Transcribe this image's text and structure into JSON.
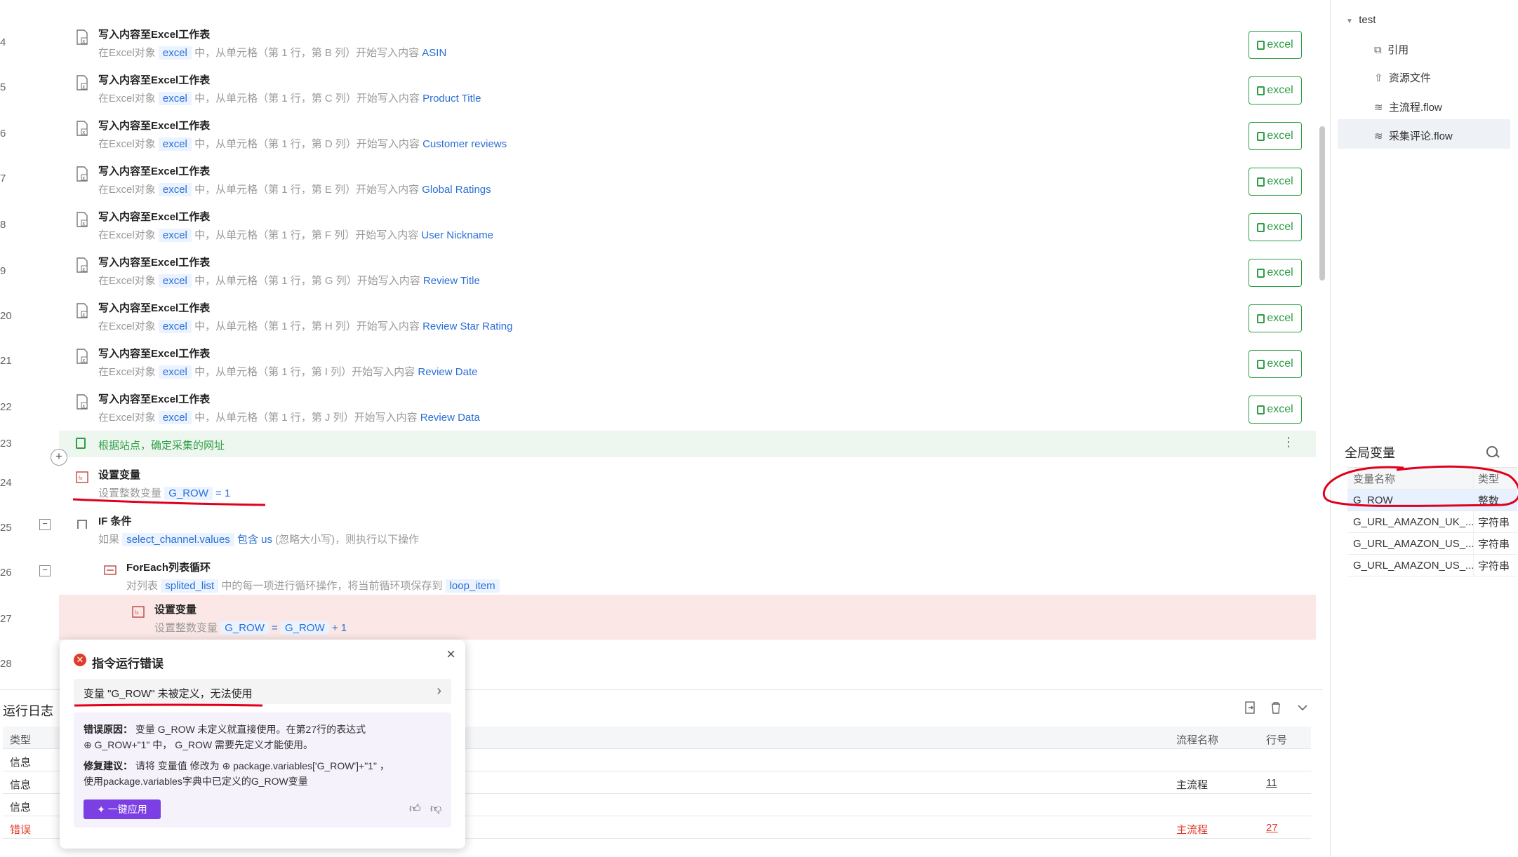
{
  "editor": {
    "line_numbers": [
      "4",
      "5",
      "6",
      "7",
      "8",
      "9",
      "20",
      "21",
      "22",
      "23",
      "24",
      "25",
      "26",
      "27",
      "28"
    ],
    "write_steps": [
      {
        "title": "写入内容至Excel工作表",
        "prefix": "在Excel对象",
        "var": "excel",
        "mid": "中，从单元格（第 1 行，第 B 列）开始写入内容",
        "content": "ASIN",
        "button": "excel"
      },
      {
        "title": "写入内容至Excel工作表",
        "prefix": "在Excel对象",
        "var": "excel",
        "mid": "中，从单元格（第 1 行，第 C 列）开始写入内容",
        "content": "Product Title",
        "button": "excel"
      },
      {
        "title": "写入内容至Excel工作表",
        "prefix": "在Excel对象",
        "var": "excel",
        "mid": "中，从单元格（第 1 行，第 D 列）开始写入内容",
        "content": "Customer reviews",
        "button": "excel"
      },
      {
        "title": "写入内容至Excel工作表",
        "prefix": "在Excel对象",
        "var": "excel",
        "mid": "中，从单元格（第 1 行，第 E 列）开始写入内容",
        "content": "Global Ratings",
        "button": "excel"
      },
      {
        "title": "写入内容至Excel工作表",
        "prefix": "在Excel对象",
        "var": "excel",
        "mid": "中，从单元格（第 1 行，第 F 列）开始写入内容",
        "content": "User Nickname",
        "button": "excel"
      },
      {
        "title": "写入内容至Excel工作表",
        "prefix": "在Excel对象",
        "var": "excel",
        "mid": "中，从单元格（第 1 行，第 G 列）开始写入内容",
        "content": "Review Title",
        "button": "excel"
      },
      {
        "title": "写入内容至Excel工作表",
        "prefix": "在Excel对象",
        "var": "excel",
        "mid": "中，从单元格（第 1 行，第 H 列）开始写入内容",
        "content": "Review Star Rating",
        "button": "excel"
      },
      {
        "title": "写入内容至Excel工作表",
        "prefix": "在Excel对象",
        "var": "excel",
        "mid": "中，从单元格（第 1 行，第 I 列）开始写入内容",
        "content": "Review Date",
        "button": "excel"
      },
      {
        "title": "写入内容至Excel工作表",
        "prefix": "在Excel对象",
        "var": "excel",
        "mid": "中，从单元格（第 1 行，第 J 列）开始写入内容",
        "content": "Review Data",
        "button": "excel"
      }
    ],
    "comment": "根据站点，确定采集的网址",
    "set_var": {
      "title": "设置变量",
      "prefix": "设置整数变量",
      "var": "G_ROW",
      "suffix": "= 1"
    },
    "if_step": {
      "title": "IF 条件",
      "prefix": "如果",
      "var": "select_channel.values",
      "op": "包含",
      "value": "us",
      "suffix": "(忽略大小写)，则执行以下操作"
    },
    "foreach": {
      "title": "ForEach列表循环",
      "prefix": "对列表",
      "var": "splited_list",
      "mid": "中的每一项进行循环操作，将当前循环项保存到",
      "item": "loop_item"
    },
    "set_var2": {
      "title": "设置变量",
      "prefix": "设置整数变量",
      "var": "G_ROW",
      "eq": "=",
      "var2": "G_ROW",
      "suffix": "+ 1"
    }
  },
  "tree": {
    "root": "test",
    "items": [
      "引用",
      "资源文件",
      "主流程.flow",
      "采集评论.flow"
    ]
  },
  "global_vars": {
    "title": "全局变量",
    "headers": [
      "变量名称",
      "类型"
    ],
    "rows": [
      {
        "name": "G_ROW",
        "type": "整数"
      },
      {
        "name": "G_URL_AMAZON_UK_...",
        "type": "字符串"
      },
      {
        "name": "G_URL_AMAZON_US_...",
        "type": "字符串"
      },
      {
        "name": "G_URL_AMAZON_US_...",
        "type": "字符串"
      }
    ]
  },
  "run_log": {
    "title": "运行日志",
    "headers": {
      "type": "类型",
      "flow": "流程名称",
      "line": "行号"
    },
    "rows": [
      {
        "type": "信息",
        "flow": "",
        "line": ""
      },
      {
        "type": "信息",
        "flow": "主流程",
        "line": "11"
      },
      {
        "type": "信息",
        "flow": "",
        "line": ""
      },
      {
        "type": "错误",
        "flow": "主流程",
        "line": "27"
      }
    ]
  },
  "error_popup": {
    "title": "指令运行错误",
    "message": "变量 \"G_ROW\" 未被定义，无法使用",
    "reason_label": "错误原因：",
    "reason_l1": "变量 G_ROW 未定义就直接使用。在第27行的表达式",
    "reason_l2": "⊕ G_ROW+\"1\" 中， G_ROW 需要先定义才能使用。",
    "fix_label": "修复建议：",
    "fix_l1": "请将 变量值 修改为 ⊕ package.variables['G_ROW']+\"1\" ，",
    "fix_l2": "使用package.variables字典中已定义的G_ROW变量",
    "apply_label": "✦ 一键应用"
  },
  "colors": {
    "accent_blue": "#2a6fd6",
    "green": "#2e9d45",
    "error_red": "#e03c2c",
    "annotation_red": "#e0001b",
    "purple": "#7b3fe4"
  }
}
